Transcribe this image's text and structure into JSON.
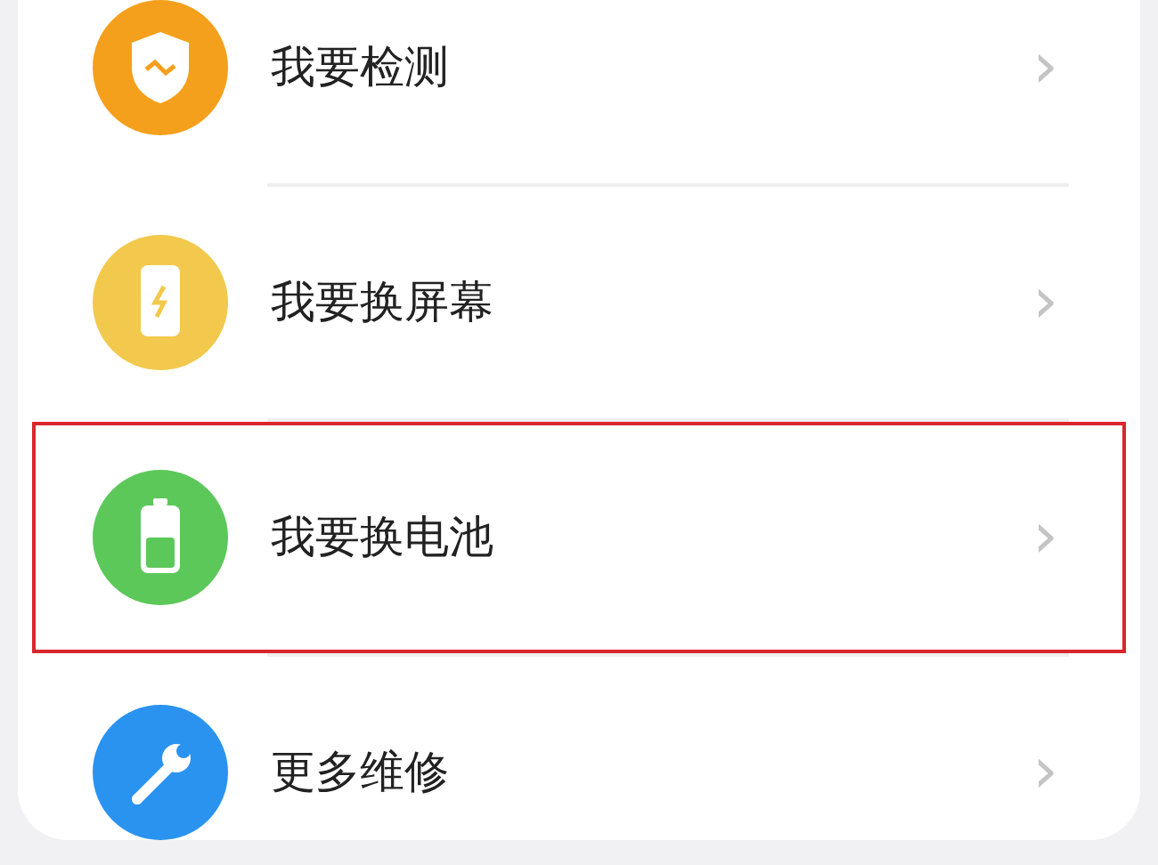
{
  "menu": {
    "items": [
      {
        "label": "我要检测",
        "kind": "shield",
        "color": "#f5a01c",
        "selected": false,
        "chevron": "›"
      },
      {
        "label": "我要换屏幕",
        "kind": "phone",
        "color": "#f2c94c",
        "selected": false,
        "chevron": "›"
      },
      {
        "label": "我要换电池",
        "kind": "battery",
        "color": "#5cc85a",
        "selected": true,
        "chevron": "›"
      },
      {
        "label": "更多维修",
        "kind": "wrench",
        "color": "#2a93f0",
        "selected": false,
        "chevron": "›"
      }
    ]
  }
}
